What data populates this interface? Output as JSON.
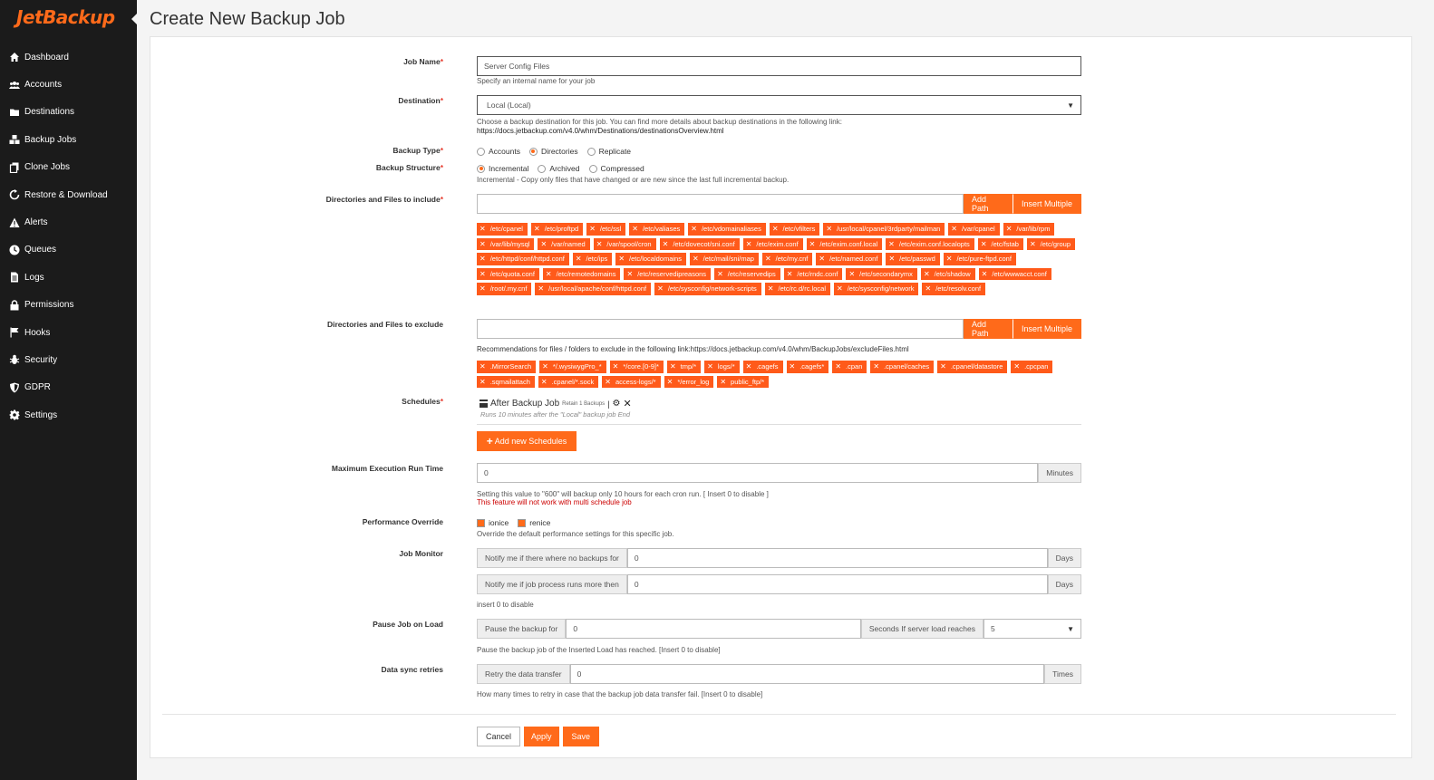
{
  "brand": {
    "logo_text": "JetBackup",
    "accent": "#ff6a1a",
    "sidebar_bg": "#1b1b1b"
  },
  "sidebar": {
    "items": [
      {
        "label": "Dashboard",
        "icon": "home-icon"
      },
      {
        "label": "Accounts",
        "icon": "users-icon"
      },
      {
        "label": "Destinations",
        "icon": "folder-icon"
      },
      {
        "label": "Backup Jobs",
        "icon": "cubes-icon"
      },
      {
        "label": "Clone Jobs",
        "icon": "copy-icon"
      },
      {
        "label": "Restore & Download",
        "icon": "refresh-icon"
      },
      {
        "label": "Alerts",
        "icon": "warning-icon"
      },
      {
        "label": "Queues",
        "icon": "clock-icon"
      },
      {
        "label": "Logs",
        "icon": "file-icon"
      },
      {
        "label": "Permissions",
        "icon": "lock-icon"
      },
      {
        "label": "Hooks",
        "icon": "flag-icon"
      },
      {
        "label": "Security",
        "icon": "bug-icon"
      },
      {
        "label": "GDPR",
        "icon": "shield-icon"
      },
      {
        "label": "Settings",
        "icon": "gear-icon"
      }
    ]
  },
  "page": {
    "title": "Create New Backup Job"
  },
  "form": {
    "job_name": {
      "label": "Job Name",
      "required": "*",
      "value": "Server Config Files",
      "help": "Specify an internal name for your job"
    },
    "destination": {
      "label": "Destination",
      "required": "*",
      "value": "Local (Local)",
      "help1": "Choose a backup destination for this job. You can find more details about backup destinations in the following link:",
      "help2": "https://docs.jetbackup.com/v4.0/whm/Destinations/destinationsOverview.html"
    },
    "backup_type": {
      "label": "Backup Type",
      "required": "*",
      "options": [
        "Accounts",
        "Directories",
        "Replicate"
      ],
      "selected": "Directories"
    },
    "backup_structure": {
      "label": "Backup Structure",
      "required": "*",
      "options": [
        "Incremental",
        "Archived",
        "Compressed"
      ],
      "selected": "Incremental",
      "help": "Incremental - Copy only files that have changed or are new since the last full incremental backup."
    },
    "include": {
      "label": "Directories and Files to include",
      "required": "*",
      "add_path": "Add Path",
      "insert_multiple": "Insert Multiple",
      "tags": [
        "/etc/cpanel",
        "/etc/proftpd",
        "/etc/ssl",
        "/etc/valiases",
        "/etc/vdomainaliases",
        "/etc/vfilters",
        "/usr/local/cpanel/3rdparty/mailman",
        "/var/cpanel",
        "/var/lib/rpm",
        "/var/lib/mysql",
        "/var/named",
        "/var/spool/cron",
        "/etc/dovecot/sni.conf",
        "/etc/exim.conf",
        "/etc/exim.conf.local",
        "/etc/exim.conf.localopts",
        "/etc/fstab",
        "/etc/group",
        "/etc/httpd/conf/httpd.conf",
        "/etc/ips",
        "/etc/localdomains",
        "/etc/mail/sni/map",
        "/etc/my.cnf",
        "/etc/named.conf",
        "/etc/passwd",
        "/etc/pure-ftpd.conf",
        "/etc/quota.conf",
        "/etc/remotedomains",
        "/etc/reservedipreasons",
        "/etc/reservedips",
        "/etc/rndc.conf",
        "/etc/secondarymx",
        "/etc/shadow",
        "/etc/wwwacct.conf",
        "/root/.my.cnf",
        "/usr/local/apache/conf/httpd.conf",
        "/etc/sysconfig/network-scripts",
        "/etc/rc.d/rc.local",
        "/etc/sysconfig/network",
        "/etc/resolv.conf"
      ]
    },
    "exclude": {
      "label": "Directories and Files to exclude",
      "add_path": "Add Path",
      "insert_multiple": "Insert Multiple",
      "help": "Recommendations for files / folders to exclude in the following link:https://docs.jetbackup.com/v4.0/whm/BackupJobs/excludeFiles.html",
      "tags": [
        ".MirrorSearch",
        "*/.wysiwygPro_*",
        "*/core.[0-9]*",
        "tmp/*",
        "logs/*",
        ".cagefs",
        ".cagefs*",
        ".cpan",
        ".cpanel/caches",
        ".cpanel/datastore",
        ".cpcpan",
        ".sqmailattach",
        ".cpanel/*.sock",
        "access-logs/*",
        "*/error_log",
        "public_ftp/*"
      ]
    },
    "schedules": {
      "label": "Schedules",
      "required": "*",
      "item_title": "After Backup Job",
      "item_retain": "Retain 1 Backups",
      "item_sep": "|",
      "item_desc": "Runs 10 minutes after the \"Local\" backup job End",
      "add_button": "Add new Schedules"
    },
    "max_exec": {
      "label": "Maximum Execution Run Time",
      "value": "0",
      "unit": "Minutes",
      "help": "Setting this value to \"600\" will backup only 10 hours for each cron run. [ Insert 0 to disable ]",
      "warning": "This feature will not work with multi schedule job"
    },
    "performance": {
      "label": "Performance Override",
      "options": [
        "ionice",
        "renice"
      ],
      "help": "Override the default performance settings for this specific job."
    },
    "job_monitor": {
      "label": "Job Monitor",
      "row1_label": "Notify me if there where no backups for",
      "row1_value": "0",
      "row1_unit": "Days",
      "row2_label": "Notify me if job process runs more then",
      "row2_value": "0",
      "row2_unit": "Days",
      "help": "insert 0 to disable"
    },
    "pause_job": {
      "label": "Pause Job on Load",
      "prefix": "Pause the backup for",
      "value": "0",
      "mid": "Seconds If server load reaches",
      "load_value": "5",
      "help": "Pause the backup job of the Inserted Load has reached. [Insert 0 to disable]"
    },
    "data_sync": {
      "label": "Data sync retries",
      "prefix": "Retry the data transfer",
      "value": "0",
      "unit": "Times",
      "help": "How many times to retry in case that the backup job data transfer fail. [Insert 0 to disable]"
    }
  },
  "footer": {
    "cancel": "Cancel",
    "apply": "Apply",
    "save": "Save"
  }
}
